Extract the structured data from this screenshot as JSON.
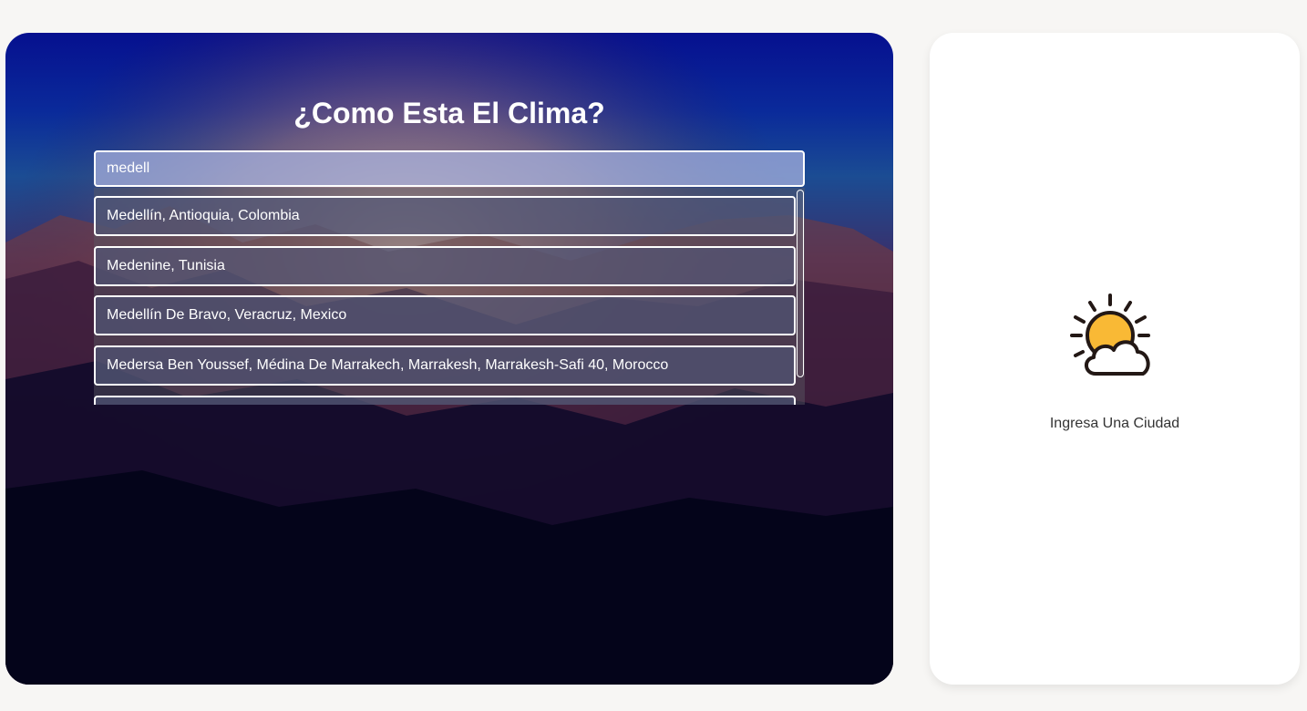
{
  "main": {
    "title": "¿Como Esta El Clima?",
    "search": {
      "value": "medell"
    },
    "suggestions": [
      "Medellín, Antioquia, Colombia",
      "Medenine, Tunisia",
      "Medellín De Bravo, Veracruz, Mexico",
      "Medersa Ben Youssef, Médina De Marrakech, Marrakesh, Marrakesh-Safi 40, Morocco",
      ""
    ]
  },
  "weather_panel": {
    "icon": "partly-cloudy-icon",
    "message": "Ingresa Una Ciudad"
  },
  "colors": {
    "sun": "#f9b935",
    "outline": "#231815",
    "card_bg": "#ffffff",
    "page_bg": "#f7f6f4"
  }
}
